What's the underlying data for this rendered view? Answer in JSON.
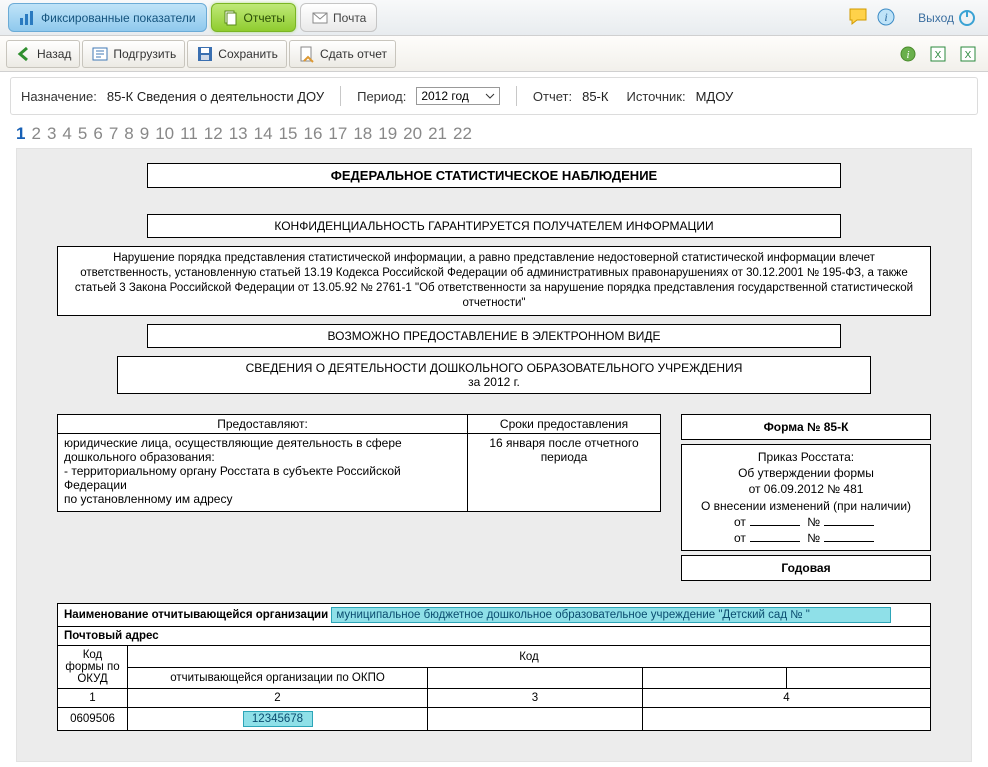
{
  "topbar": {
    "tab_fixed": "Фиксированные показатели",
    "tab_reports": "Отчеты",
    "tab_mail": "Почта",
    "exit": "Выход"
  },
  "toolbar": {
    "back": "Назад",
    "upload": "Подгрузить",
    "save": "Сохранить",
    "submit": "Сдать отчет"
  },
  "info": {
    "purpose_label": "Назначение:",
    "purpose_value": "85-К Сведения о деятельности ДОУ",
    "period_label": "Период:",
    "period_value": "2012 год",
    "report_label": "Отчет:",
    "report_value": "85-К",
    "source_label": "Источник:",
    "source_value": "МДОУ"
  },
  "pagenav": {
    "pages": [
      "1",
      "2",
      "3",
      "4",
      "5",
      "6",
      "7",
      "8",
      "9",
      "10",
      "11",
      "12",
      "13",
      "14",
      "15",
      "16",
      "17",
      "18",
      "19",
      "20",
      "21",
      "22"
    ],
    "current": 0
  },
  "headers": {
    "title1": "ФЕДЕРАЛЬНОЕ СТАТИСТИЧЕСКОЕ НАБЛЮДЕНИЕ",
    "title2": "КОНФИДЕНЦИАЛЬНОСТЬ ГАРАНТИРУЕТСЯ ПОЛУЧАТЕЛЕМ ИНФОРМАЦИИ",
    "legal": "Нарушение порядка представления статистической информации, а равно представление недостоверной статистической информации влечет ответственность, установленную статьей 13.19 Кодекса Российской Федерации об административных правонарушениях от 30.12.2001 № 195-ФЗ, а также статьей 3 Закона Российской Федерации от 13.05.92 № 2761-1 \"Об ответственности за нарушение порядка представления государственной статистической отчетности\"",
    "title3": "ВОЗМОЖНО ПРЕДОСТАВЛЕНИЕ В ЭЛЕКТРОННОМ ВИДЕ",
    "title4a": "СВЕДЕНИЯ О ДЕЯТЕЛЬНОСТИ ДОШКОЛЬНОГО ОБРАЗОВАТЕЛЬНОГО УЧРЕЖДЕНИЯ",
    "title4b": "за 2012 г."
  },
  "provide_table": {
    "col1_head": "Предоставляют:",
    "col2_head": "Сроки предоставления",
    "col1_body": "юридические лица, осуществляющие деятельность в сфере дошкольного образования:\n- территориальному органу Росстата в субъекте Российской Федерации\nпо установленному им адресу",
    "col2_body": "16 января после отчетного периода"
  },
  "right_panel": {
    "form_no": "Форма № 85-К",
    "order1": "Приказ Росстата:",
    "order2": "Об утверждении формы",
    "order3": "от 06.09.2012 № 481",
    "order4": "О внесении изменений (при наличии)",
    "ot": "от",
    "num_sign": "№",
    "annual": "Годовая"
  },
  "org_table": {
    "name_label": "Наименование отчитывающейся организации",
    "name_value": "муниципальное бюджетное дошкольное образовательное учреждение \"Детский сад №       \"",
    "address_label": "Почтовый адрес",
    "okud_label": "Код формы по ОКУД",
    "kod_label": "Код",
    "okpo_label": "отчитывающейся организации по ОКПО",
    "row_nums": [
      "1",
      "2",
      "3",
      "4"
    ],
    "okud_value": "0609506",
    "okpo_value": "12345678"
  }
}
